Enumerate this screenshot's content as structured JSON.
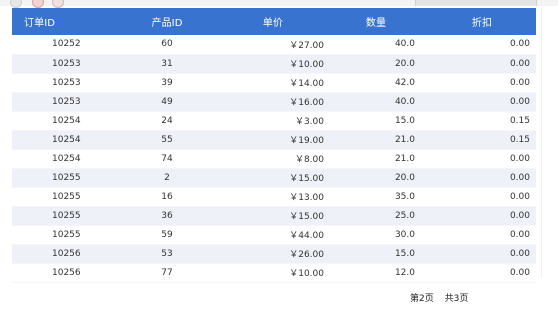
{
  "table": {
    "headers": {
      "order_id": "订单ID",
      "product_id": "产品ID",
      "unit_price": "单价",
      "quantity": "数量",
      "discount": "折扣"
    },
    "rows": [
      {
        "order_id": "10252",
        "product_id": "60",
        "unit_price": "￥27.00",
        "quantity": "40.0",
        "discount": "0.00"
      },
      {
        "order_id": "10253",
        "product_id": "31",
        "unit_price": "￥10.00",
        "quantity": "20.0",
        "discount": "0.00"
      },
      {
        "order_id": "10253",
        "product_id": "39",
        "unit_price": "￥14.00",
        "quantity": "42.0",
        "discount": "0.00"
      },
      {
        "order_id": "10253",
        "product_id": "49",
        "unit_price": "￥16.00",
        "quantity": "40.0",
        "discount": "0.00"
      },
      {
        "order_id": "10254",
        "product_id": "24",
        "unit_price": "￥3.00",
        "quantity": "15.0",
        "discount": "0.15"
      },
      {
        "order_id": "10254",
        "product_id": "55",
        "unit_price": "￥19.00",
        "quantity": "21.0",
        "discount": "0.15"
      },
      {
        "order_id": "10254",
        "product_id": "74",
        "unit_price": "￥8.00",
        "quantity": "21.0",
        "discount": "0.00"
      },
      {
        "order_id": "10255",
        "product_id": "2",
        "unit_price": "￥15.00",
        "quantity": "20.0",
        "discount": "0.00"
      },
      {
        "order_id": "10255",
        "product_id": "16",
        "unit_price": "￥13.00",
        "quantity": "35.0",
        "discount": "0.00"
      },
      {
        "order_id": "10255",
        "product_id": "36",
        "unit_price": "￥15.00",
        "quantity": "25.0",
        "discount": "0.00"
      },
      {
        "order_id": "10255",
        "product_id": "59",
        "unit_price": "￥44.00",
        "quantity": "30.0",
        "discount": "0.00"
      },
      {
        "order_id": "10256",
        "product_id": "53",
        "unit_price": "￥26.00",
        "quantity": "15.0",
        "discount": "0.00"
      },
      {
        "order_id": "10256",
        "product_id": "77",
        "unit_price": "￥10.00",
        "quantity": "12.0",
        "discount": "0.00"
      }
    ]
  },
  "pager": {
    "current_page": "第2页",
    "total_pages": "共3页"
  },
  "colors": {
    "header_bg": "#3874cf",
    "header_text": "#ffffff",
    "row_alt_bg": "#eef1f7"
  }
}
